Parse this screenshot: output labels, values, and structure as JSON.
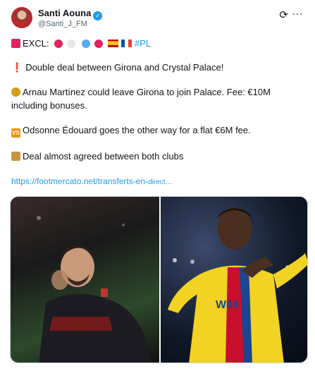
{
  "author": {
    "name": "Santi Aouna",
    "handle": "@Santi_J_FM"
  },
  "icons": {
    "verified": "verified-badge-icon",
    "grok": "grok-icon",
    "more": "more-icon"
  },
  "tweet": {
    "line1_label": "EXCL:",
    "line1_hashtag": "#PL",
    "line2": "Double deal between Girona and Crystal Palace!",
    "line3a": "Arnau Martínez could leave Girona to join Palace. Fee: €10M",
    "line3b": "including bonuses.",
    "line4": "Odsonne Édouard goes the other way for a flat €6M fee.",
    "line5": "Deal almost agreed between both clubs",
    "link_main": "https://footmercato.net/transferts-en-",
    "link_tail": "direct…"
  },
  "colors": {
    "link": "#1d9bf0",
    "text": "#0f1419",
    "muted": "#536471"
  }
}
